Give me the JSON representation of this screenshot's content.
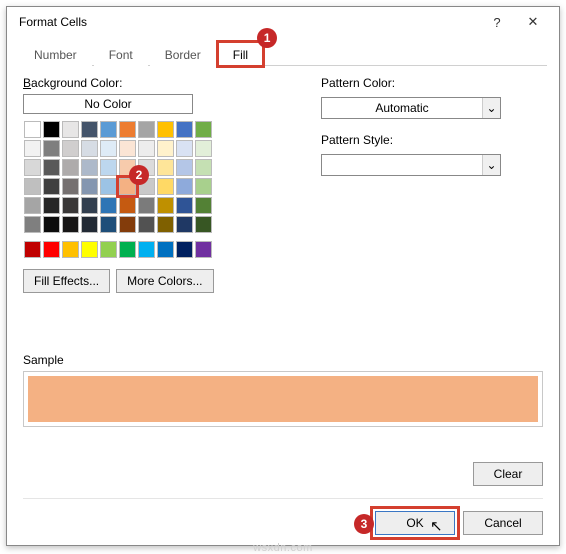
{
  "title": "Format Cells",
  "help_glyph": "?",
  "close_glyph": "✕",
  "tabs": {
    "number": "Number",
    "font": "Font",
    "border": "Border",
    "fill": "Fill",
    "active": "fill"
  },
  "markers": {
    "one": "1",
    "two": "2",
    "three": "3"
  },
  "left": {
    "bg_label_prefix": "B",
    "bg_label_rest": "ackground Color:",
    "no_color": "No Color",
    "fill_effects": "Fill Effects...",
    "more_colors": "More Colors...",
    "theme_rows": [
      [
        "#ffffff",
        "#000000",
        "#e7e6e6",
        "#44546a",
        "#5b9bd5",
        "#ed7d31",
        "#a5a5a5",
        "#ffc000",
        "#4472c4",
        "#70ad47"
      ],
      [
        "#f2f2f2",
        "#7f7f7f",
        "#d0cece",
        "#d6dce4",
        "#deebf6",
        "#fbe5d5",
        "#ededed",
        "#fff2cc",
        "#d9e2f3",
        "#e2efd9"
      ],
      [
        "#d8d8d8",
        "#595959",
        "#aeabab",
        "#adb9ca",
        "#bdd7ee",
        "#f7cbac",
        "#dbdbdb",
        "#fee599",
        "#b4c6e7",
        "#c5e0b3"
      ],
      [
        "#bfbfbf",
        "#3f3f3f",
        "#757070",
        "#8496b0",
        "#9cc3e5",
        "#f4b183",
        "#c9c9c9",
        "#ffd965",
        "#8eaadb",
        "#a8d08d"
      ],
      [
        "#a5a5a5",
        "#262626",
        "#3a3838",
        "#323f4f",
        "#2e75b5",
        "#c55a11",
        "#7b7b7b",
        "#bf9000",
        "#2f5496",
        "#538135"
      ],
      [
        "#7f7f7f",
        "#0c0c0c",
        "#171616",
        "#222a35",
        "#1e4e79",
        "#833c0b",
        "#525252",
        "#7f6000",
        "#1f3864",
        "#375623"
      ]
    ],
    "standard_row": [
      "#c00000",
      "#ff0000",
      "#ffc000",
      "#ffff00",
      "#92d050",
      "#00b050",
      "#00b0f0",
      "#0070c0",
      "#002060",
      "#7030a0"
    ],
    "selected": {
      "row": 3,
      "col": 5
    }
  },
  "right": {
    "pattern_color_label": "Pattern Color:",
    "pattern_color_value": "Automatic",
    "pattern_style_label": "Pattern Style:",
    "pattern_style_value": "",
    "arrow": "⌄"
  },
  "sample": {
    "label": "Sample",
    "color": "#f4b183"
  },
  "buttons": {
    "clear": "Clear",
    "ok": "OK",
    "cancel": "Cancel"
  },
  "watermark": "wsxdn.com"
}
